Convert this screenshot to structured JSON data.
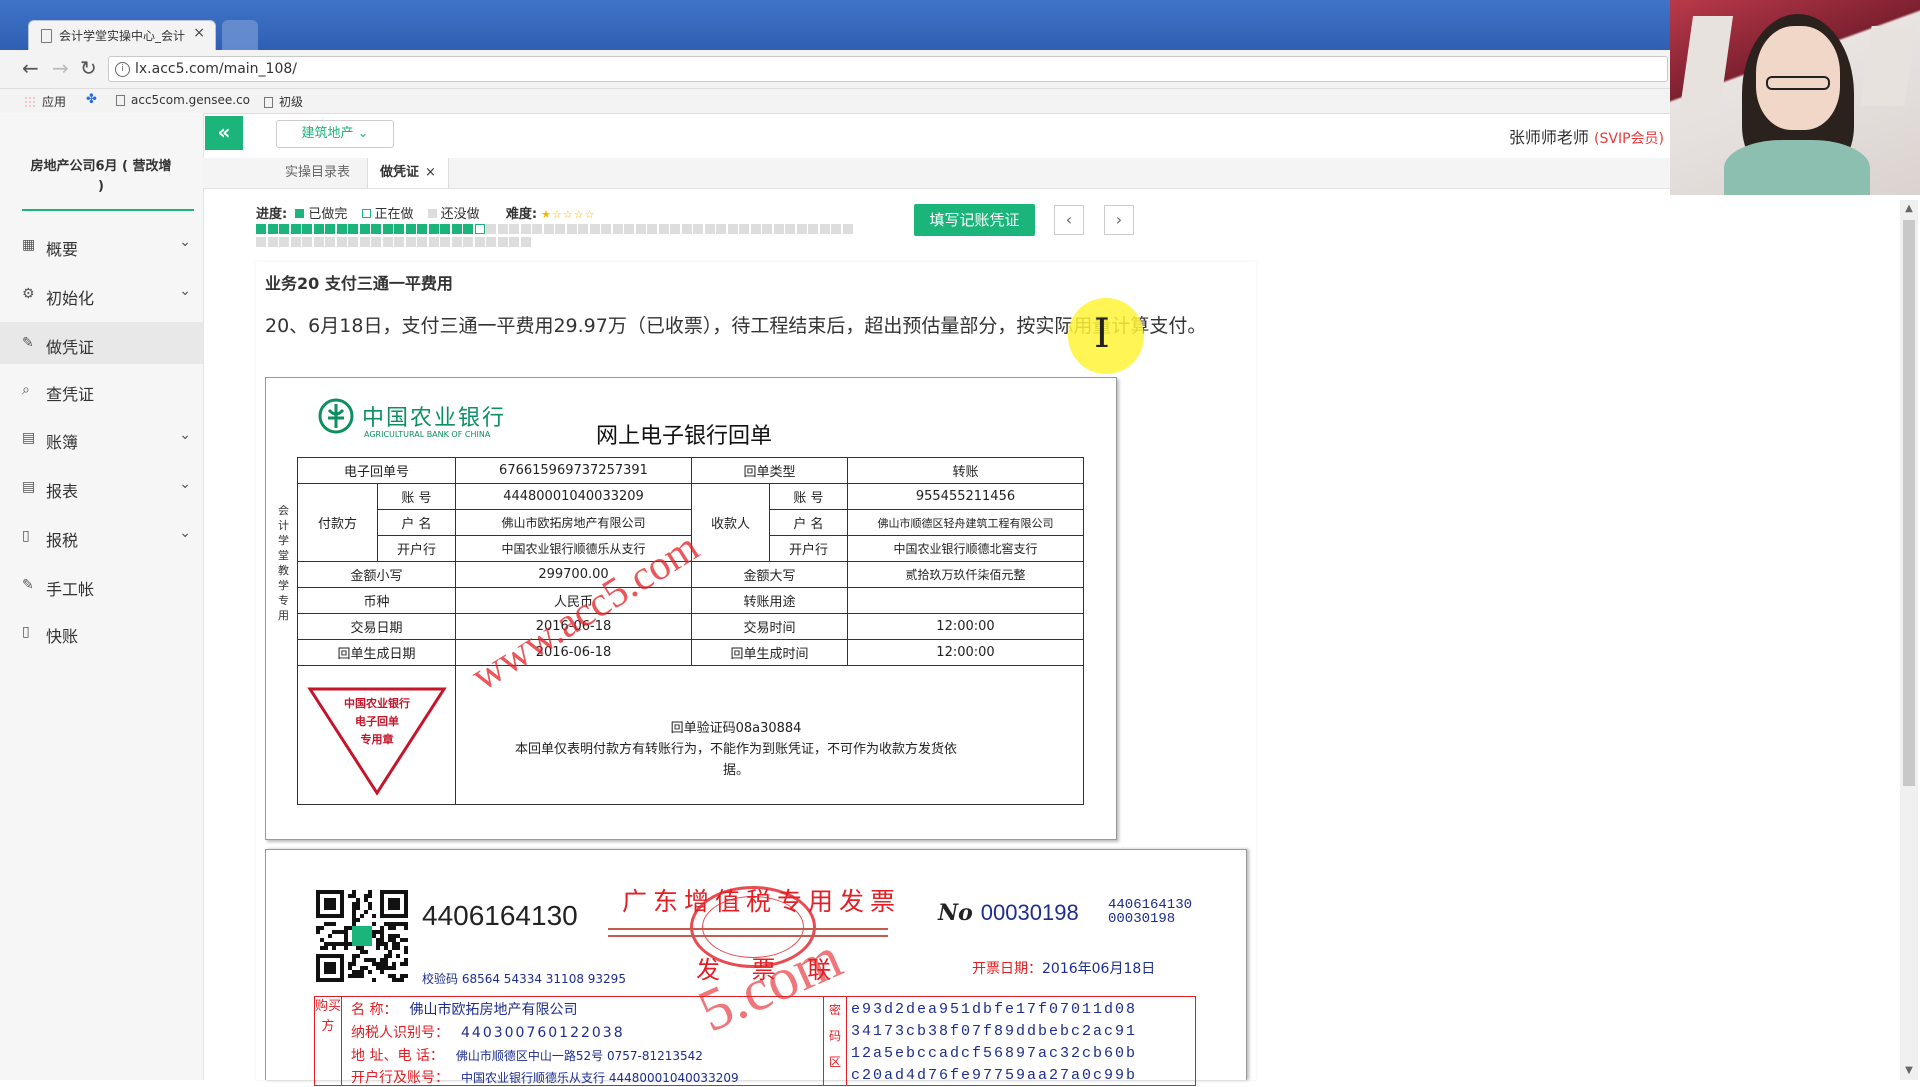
{
  "browser": {
    "tab_title": "会计学堂实操中心_会计",
    "tab_close": "×",
    "url": "lx.acc5.com/main_108/",
    "bookmarks": [
      "应用",
      "acc5com.gensee.co",
      "初级"
    ]
  },
  "header": {
    "industry": "建筑地产",
    "user_name": "张师师老师",
    "user_badge": "(SVIP会员)"
  },
  "sidebar": {
    "company": "房地产公司6月 ( 营改增 )",
    "items": [
      {
        "label": "概要",
        "icon": "overview-icon",
        "chevron": true
      },
      {
        "label": "初始化",
        "icon": "gear-icon",
        "chevron": true
      },
      {
        "label": "做凭证",
        "icon": "pencil-icon",
        "chevron": false,
        "active": true
      },
      {
        "label": "查凭证",
        "icon": "search-icon",
        "chevron": false
      },
      {
        "label": "账簿",
        "icon": "book-icon",
        "chevron": true
      },
      {
        "label": "报表",
        "icon": "report-icon",
        "chevron": true
      },
      {
        "label": "报税",
        "icon": "document-icon",
        "chevron": true
      },
      {
        "label": "手工帐",
        "icon": "pencil-icon",
        "chevron": false
      },
      {
        "label": "快账",
        "icon": "document-icon",
        "chevron": false
      }
    ]
  },
  "tabs": {
    "catalog": "实操目录表",
    "voucher": "做凭证",
    "voucher_close": "×"
  },
  "progress": {
    "label": "进度:",
    "done": "已做完",
    "doing": "正在做",
    "todo": "还没做",
    "difficulty_label": "难度:",
    "difficulty_stars": "★☆☆☆☆",
    "difficulty_level": 1,
    "difficulty_max": 5,
    "total": 76,
    "done_count": 19,
    "doing_index": 19
  },
  "actions": {
    "fill": "填写记账凭证",
    "prev": "‹",
    "next": "›"
  },
  "task": {
    "title": "业务20 支付三通一平费用",
    "description": "20、6月18日，支付三通一平费用29.97万（已收票），待工程结束后，超出预估量部分，按实际用量计算支付。"
  },
  "receipt": {
    "bank_cn": "中国农业银行",
    "bank_en": "AGRICULTURAL BANK OF CHINA",
    "title": "网上电子银行回单",
    "side_text": "会计学堂教学专用",
    "labels": {
      "receipt_no": "电子回单号",
      "receipt_type": "回单类型",
      "payer": "付款方",
      "payee": "收款人",
      "account": "账 号",
      "name": "户 名",
      "bank": "开户行",
      "amount_small": "金额小写",
      "amount_big": "金额大写",
      "currency": "币种",
      "purpose": "转账用途",
      "trade_date": "交易日期",
      "trade_time": "交易时间",
      "gen_date": "回单生成日期",
      "gen_time": "回单生成时间"
    },
    "values": {
      "receipt_no": "676615969737257391",
      "receipt_type": "转账",
      "payer_account": "44480001040033209",
      "payer_name": "佛山市欧拓房地产有限公司",
      "payer_bank": "中国农业银行顺德乐从支行",
      "payee_account": "955455211456",
      "payee_name": "佛山市顺德区轻舟建筑工程有限公司",
      "payee_bank": "中国农业银行顺德北窖支行",
      "amount_small": "299700.00",
      "amount_big": "贰拾玖万玖仟柒佰元整",
      "currency": "人民币",
      "purpose": "",
      "trade_date": "2016-06-18",
      "trade_time": "12:00:00",
      "gen_date": "2016-06-18",
      "gen_time": "12:00:00"
    },
    "stamp": [
      "中国农业银行",
      "电子回单",
      "专用章"
    ],
    "verify_code": "回单验证码08a30884",
    "note": "本回单仅表明付款方有转账行为，不能作为到账凭证，不可作为收款方发货依据。",
    "watermark": "www.acc5.com"
  },
  "invoice": {
    "code": "4406164130",
    "check_code": "校验码 68564 54334 31108 93295",
    "title": "广东增值税专用发票",
    "copy_label": "发 票 联",
    "no_label": "No",
    "number": "00030198",
    "small_code": "4406164130",
    "small_number": "00030198",
    "date_label": "开票日期：",
    "date": "2016年06月18日",
    "buyer_side": "购买方",
    "buyer_name_label": "名        称：",
    "buyer_name": "佛山市欧拓房地产有限公司",
    "buyer_tax_label": "纳税人识别号：",
    "buyer_tax": "440300760122038",
    "buyer_addr_label": "地 址、电 话：",
    "buyer_addr": "佛山市顺德区中山一路52号 0757-81213542",
    "buyer_bank_label": "开户行及账号：",
    "buyer_bank": "中国农业银行顺德乐从支行 44480001040033209",
    "pwd_side": "密码区",
    "pwd_lines": [
      "e93d2dea951dbfe17f07011d08",
      "34173cb38f07f89ddbebc2ac91",
      "12a5ebccadcf56897ac32cb60b",
      "c20ad4d76fe97759aa27a0c99b"
    ],
    "watermark": "5.com"
  }
}
